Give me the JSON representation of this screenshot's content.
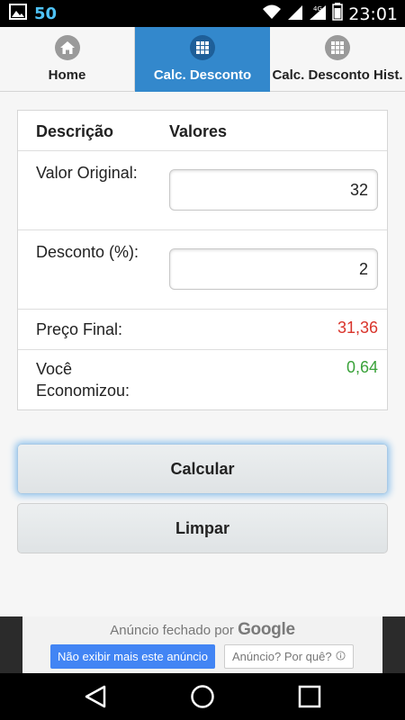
{
  "status_bar": {
    "left_number": "50",
    "clock": "23:01",
    "icons": [
      "image-icon",
      "wifi-icon",
      "signal-icon",
      "signal-4g-icon",
      "battery-icon"
    ]
  },
  "tabs": [
    {
      "label": "Home",
      "icon": "home-icon",
      "active": false
    },
    {
      "label": "Calc. Desconto",
      "icon": "grid-icon",
      "active": true
    },
    {
      "label": "Calc. Desconto Hist.",
      "icon": "grid-icon",
      "active": false
    }
  ],
  "table": {
    "header_desc": "Descrição",
    "header_values": "Valores",
    "original_label": "Valor Original:",
    "original_value": "32",
    "discount_label": "Desconto (%):",
    "discount_value": "2",
    "final_label": "Preço Final:",
    "final_value": "31,36",
    "saved_label": "Você Economizou:",
    "saved_value": "0,64"
  },
  "buttons": {
    "calculate": "Calcular",
    "clear": "Limpar"
  },
  "ad": {
    "closed_text": "Anúncio fechado por",
    "brand": "Google",
    "hide_button": "Não exibir mais este anúncio",
    "why_button": "Anúncio? Por quê?"
  },
  "colors": {
    "tab_active": "#3388cc",
    "final_value": "#d9342b",
    "saved_value": "#3aa23a",
    "ad_button": "#4285f4"
  }
}
